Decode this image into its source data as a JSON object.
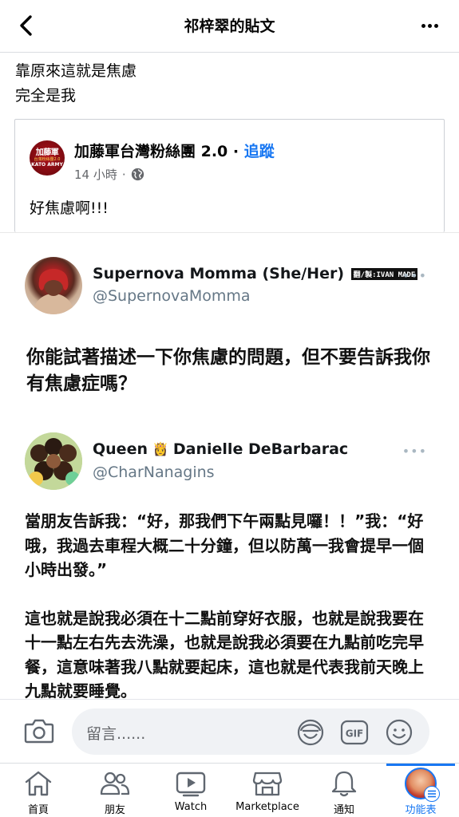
{
  "header": {
    "title": "祁梓翠的貼文"
  },
  "post": {
    "text_line1": "靠原來這就是焦慮",
    "text_line2": "完全是我"
  },
  "shared": {
    "page_name": "加藤軍台灣粉絲團 2.0",
    "separator": "·",
    "follow_label": "追蹤",
    "time": "14 小時",
    "meta_sep": "·",
    "text": "好焦慮啊!!!",
    "avatar_line1": "加藤軍",
    "avatar_line2": "台灣粉絲團2.0",
    "avatar_line3": "KATO ARMY"
  },
  "tweet1": {
    "name": "Supernova Momma (She/Her)",
    "watermark": "翻/製:IVAN MADE",
    "handle": "@SupernovaMomma",
    "dots": "•••",
    "body": "你能試著描述一下你焦慮的問題，但不要告訴我你有焦慮症嗎？"
  },
  "tweet2": {
    "name_part1": "Queen",
    "crown": "👸",
    "name_part2": "Danielle DeBarbarac",
    "handle": "@CharNanagins",
    "dots": "•••",
    "para1": "當朋友告訴我：“好，那我們下午兩點見囉！！”我：“好哦，我過去車程大概二十分鐘，但以防萬一我會提早一個小時出發。”",
    "para2": "這也就是說我必須在十二點前穿好衣服，也就是說我要在十一點左右先去洗澡，也就是說我必須要在九點前吃完早餐，這意味著我八點就要起床，這也就是代表我前天晚上九點就要睡覺。"
  },
  "comment": {
    "placeholder": "留言......"
  },
  "tabs": [
    {
      "label": "首頁"
    },
    {
      "label": "朋友"
    },
    {
      "label": "Watch"
    },
    {
      "label": "Marketplace"
    },
    {
      "label": "通知"
    },
    {
      "label": "功能表"
    }
  ],
  "colors": {
    "accent": "#1877f2",
    "text": "#050505",
    "secondary": "#65676b"
  }
}
